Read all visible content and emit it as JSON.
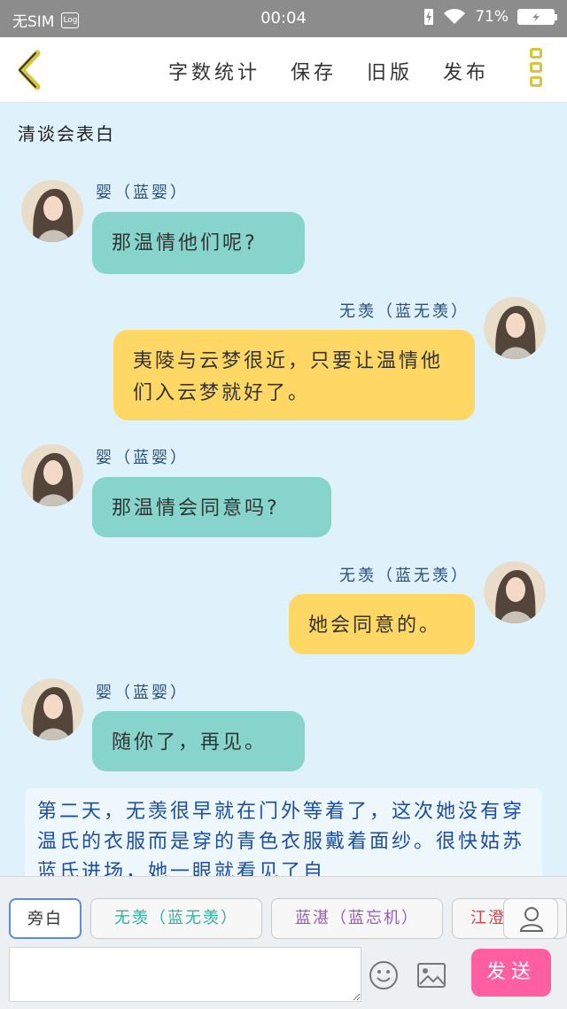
{
  "status": {
    "sim": "无SIM",
    "log": "Log",
    "time": "00:04",
    "battery": "71%"
  },
  "toolbar": {
    "actions": [
      "字数统计",
      "保存",
      "旧版",
      "发布"
    ]
  },
  "story_title": "清谈会表白",
  "messages": [
    {
      "speaker": "婴（蓝婴）",
      "text": "那温情他们呢?"
    },
    {
      "speaker": "无羡（蓝无羡）",
      "text": "夷陵与云梦很近，只要让温情他们入云梦就好了。"
    },
    {
      "speaker": "婴（蓝婴）",
      "text": "那温情会同意吗?"
    },
    {
      "speaker": "无羡（蓝无羡）",
      "text": "她会同意的。"
    },
    {
      "speaker": "婴（蓝婴）",
      "text": "随你了，再见。"
    }
  ],
  "narration": "第二天，无羡很早就在门外等着了，这次她没有穿温氏的衣服而是穿的青色衣服戴着面纱。很快姑苏蓝氏进场，她一眼就看见了自",
  "composer": {
    "chips": [
      {
        "label": "旁白",
        "color": "#555555"
      },
      {
        "label": "无羡（蓝无羡）",
        "color": "#2bb3a3"
      },
      {
        "label": "蓝湛（蓝忘机）",
        "color": "#9b59b6"
      },
      {
        "label": "江澄",
        "color": "#e04040"
      }
    ],
    "send_label": "发送",
    "input_value": ""
  },
  "colors": {
    "left_bubble": "#86d4cb",
    "right_bubble": "#ffd765",
    "send": "#ff5fa0",
    "accent_icon": "#d9c33b"
  }
}
